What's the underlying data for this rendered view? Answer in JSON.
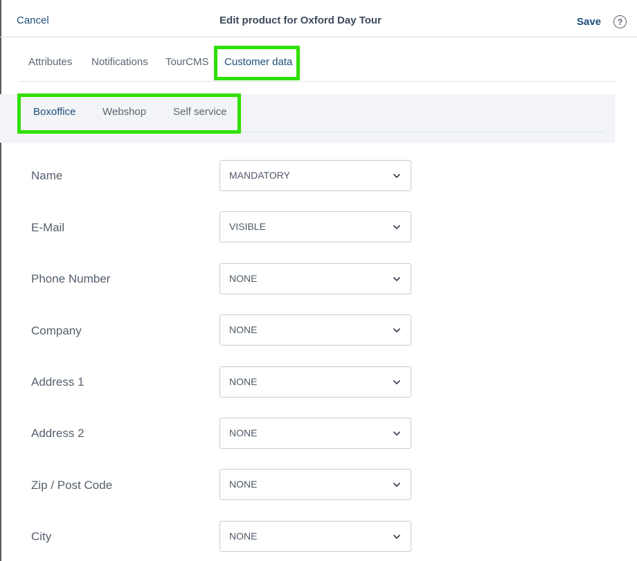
{
  "header": {
    "cancel_label": "Cancel",
    "title": "Edit product for Oxford Day Tour",
    "save_label": "Save",
    "help_icon": "?"
  },
  "tabs": [
    {
      "label": "Attributes",
      "active": false
    },
    {
      "label": "Notifications",
      "active": false
    },
    {
      "label": "TourCMS",
      "active": false
    },
    {
      "label": "Customer data",
      "active": true
    }
  ],
  "subtabs": [
    {
      "label": "Boxoffice",
      "active": true
    },
    {
      "label": "Webshop",
      "active": false
    },
    {
      "label": "Self service",
      "active": false
    }
  ],
  "fields": [
    {
      "label": "Name",
      "value": "MANDATORY"
    },
    {
      "label": "E-Mail",
      "value": "VISIBLE"
    },
    {
      "label": "Phone Number",
      "value": "NONE"
    },
    {
      "label": "Company",
      "value": "NONE"
    },
    {
      "label": "Address 1",
      "value": "NONE"
    },
    {
      "label": "Address 2",
      "value": "NONE"
    },
    {
      "label": "Zip / Post Code",
      "value": "NONE"
    },
    {
      "label": "City",
      "value": "NONE"
    }
  ],
  "colors": {
    "accent": "#1e4d78",
    "highlight": "#2fe000",
    "subnav_bg": "#f2f4f7"
  },
  "icons": {
    "select_chevron": "chevron-down-icon",
    "help": "help-circle-icon"
  }
}
